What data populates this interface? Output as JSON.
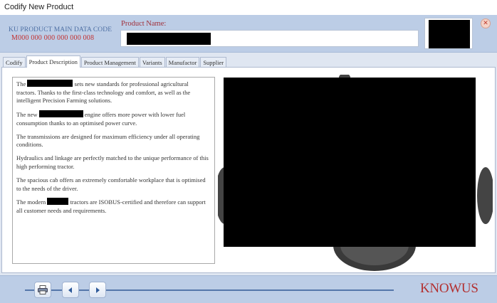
{
  "window": {
    "title": "Codify New Product"
  },
  "header": {
    "code_label": "KU PRODUCT MAIN DATA CODE",
    "code_value": "M000 000 000 000 000 008",
    "name_label": "Product Name:"
  },
  "tabs": [
    {
      "label": "Codify"
    },
    {
      "label": "Product Description",
      "active": true
    },
    {
      "label": "Product Management"
    },
    {
      "label": "Variants"
    },
    {
      "label": "Manufactor"
    },
    {
      "label": "Supplier"
    }
  ],
  "description": {
    "p1_after": "sets new standards for professional agricultural tractors. Thanks to the first-class technology and comfort, as well as the intelligent Precision Farming solutions.",
    "p1_before": "The",
    "p2_before": "The new",
    "p2_after": "engine offers more power with lower fuel consumption thanks to an optimised power curve.",
    "p3": "The transmissions are designed for maximum efficiency under all operating conditions.",
    "p4": "Hydraulics and linkage are perfectly matched to the unique performance of this high performing tractor.",
    "p5": "The spacious cab offers an extremely comfortable workplace that is optimised to the needs of the driver.",
    "p6_before": "The modern",
    "p6_after": "tractors are ISOBUS-certified and therefore can support all customer needs and requirements."
  },
  "footer": {
    "logo_text": "KNOWUS",
    "buttons": [
      "printer-icon",
      "arrow-left-icon",
      "arrow-right-icon"
    ]
  },
  "colors": {
    "header_bg": "#bccde6",
    "code_value": "#c23030",
    "accent_blue": "#5577aa",
    "logo_red": "#b33030"
  }
}
